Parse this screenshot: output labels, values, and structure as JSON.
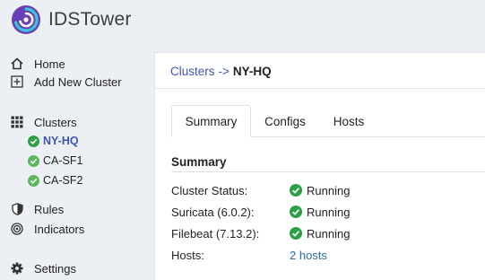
{
  "brand": {
    "name": "IDSTower",
    "logo_icon": "spiral-logo-icon"
  },
  "sidebar": {
    "top_items": [
      {
        "label": "Home",
        "icon": "home-icon"
      },
      {
        "label": "Add New Cluster",
        "icon": "plus-square-icon"
      }
    ],
    "clusters_label": "Clusters",
    "clusters": [
      {
        "label": "NY-HQ",
        "active": true
      },
      {
        "label": "CA-SF1",
        "active": false
      },
      {
        "label": "CA-SF2",
        "active": false
      }
    ],
    "rules_label": "Rules",
    "indicators_label": "Indicators",
    "settings_label": "Settings"
  },
  "breadcrumb": {
    "root": "Clusters",
    "separator": "->",
    "current": "NY-HQ"
  },
  "tabs": [
    {
      "label": "Summary",
      "active": true
    },
    {
      "label": "Configs",
      "active": false
    },
    {
      "label": "Hosts",
      "active": false
    }
  ],
  "summary": {
    "title": "Summary",
    "rows": [
      {
        "label": "Cluster Status:",
        "value": "Running"
      },
      {
        "label": "Suricata (6.0.2):",
        "value": "Running"
      },
      {
        "label": "Filebeat (7.13.2):",
        "value": "Running"
      },
      {
        "label": "Hosts:",
        "value": "2 hosts"
      }
    ]
  },
  "colors": {
    "accent": "#3d56b2",
    "link": "#2b6cb0",
    "status_ok": "#2e9e48",
    "status_ok_light": "#5cb85c"
  }
}
